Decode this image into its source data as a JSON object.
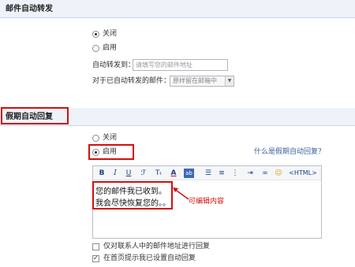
{
  "forward": {
    "title": "邮件自动转发",
    "opt_off": "关闭",
    "opt_on": "启用",
    "to_label": "自动转发到：",
    "to_placeholder": "请填写您的邮件地址",
    "keep_label": "对于已自动转发的邮件：",
    "keep_value": "原样留在邮箱中"
  },
  "vacation": {
    "title": "假期自动回复",
    "opt_off": "关闭",
    "opt_on": "启用",
    "help_link": "什么是假期自动回复？",
    "toolbar": {
      "bold": "B",
      "italic": "I",
      "underline": "U",
      "html": "<HTML>"
    },
    "body_line1": "您的邮件我已收到。",
    "body_line2": "我会尽快恢复您的。。",
    "annotation": "可编辑内容",
    "check_contacts": "仅对联系人中的邮件地址进行回复",
    "check_home": "在首页提示我已设置自动回复"
  },
  "colors": {
    "highlight": "#d10f0f",
    "link": "#3b5f9e",
    "section_bg": "#eef3f9"
  }
}
